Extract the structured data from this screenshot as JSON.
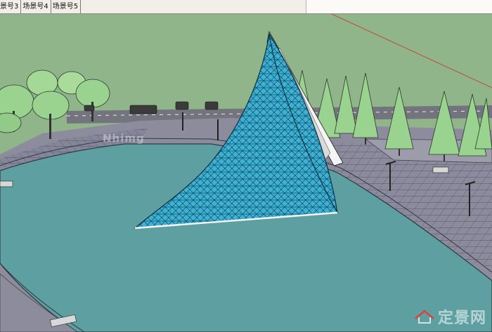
{
  "window": {
    "scene_tabs": [
      {
        "label": "景号3"
      },
      {
        "label": "场景号4"
      },
      {
        "label": "场景号5"
      }
    ]
  },
  "viewport": {
    "watermark_url": "Nhimg",
    "watermark_brand": "定景网"
  },
  "colors": {
    "sky": "#91b58a",
    "water": "#5ea0a2",
    "plaza": "#8c8c9d",
    "glass": "#3aaed0",
    "tree": "#9ad290"
  }
}
